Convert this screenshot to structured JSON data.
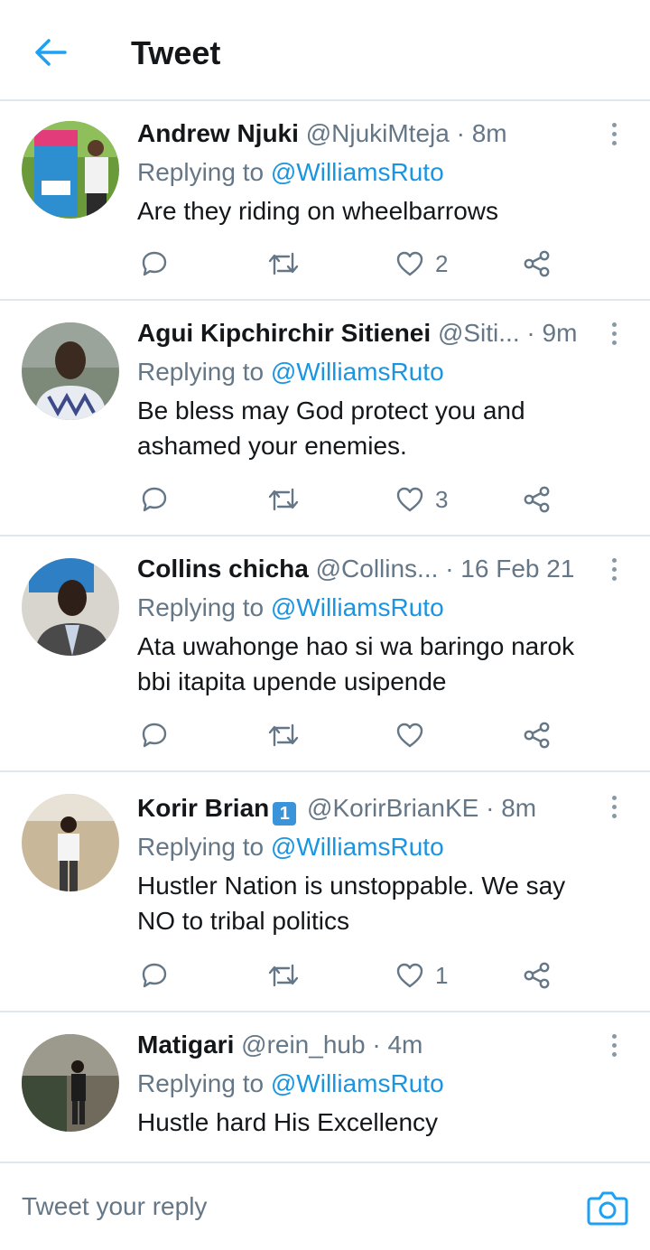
{
  "header": {
    "back_icon": "arrow-left-icon",
    "title": "Tweet"
  },
  "colors": {
    "accent": "#1da1f2",
    "mention": "#1b95e0",
    "muted": "#657786",
    "divider": "#e1e8ed"
  },
  "tweets": [
    {
      "name": "Andrew Njuki",
      "handle": "@NjukiMteja",
      "time": "8m",
      "replying_prefix": "Replying to ",
      "replying_to": "@WilliamsRuto",
      "text": "Are they riding on wheelbarrows",
      "likes": "2"
    },
    {
      "name": "Agui Kipchirchir Sitienei",
      "handle": "@Siti...",
      "time": "9m",
      "replying_prefix": "Replying to ",
      "replying_to": "@WilliamsRuto",
      "text": "Be bless may God protect you and ashamed your enemies.",
      "likes": "3"
    },
    {
      "name": "Collins chicha",
      "handle": "@Collins...",
      "time": "16 Feb 21",
      "replying_prefix": "Replying to ",
      "replying_to": "@WilliamsRuto",
      "text": "Ata uwahonge hao si wa baringo narok bbi itapita upende usipende",
      "likes": ""
    },
    {
      "name": "Korir Brian",
      "badge": "1",
      "handle": "@KorirBrianKE",
      "time": "8m",
      "replying_prefix": "Replying to ",
      "replying_to": "@WilliamsRuto",
      "text": "Hustler Nation is unstoppable. We say NO to tribal politics",
      "likes": "1"
    },
    {
      "name": "Matigari",
      "handle": "@rein_hub",
      "time": "4m",
      "replying_prefix": "Replying to ",
      "replying_to": "@WilliamsRuto",
      "text": "Hustle hard His Excellency"
    }
  ],
  "separator": "·",
  "composer": {
    "placeholder": "Tweet your reply",
    "camera_icon": "camera-icon"
  }
}
